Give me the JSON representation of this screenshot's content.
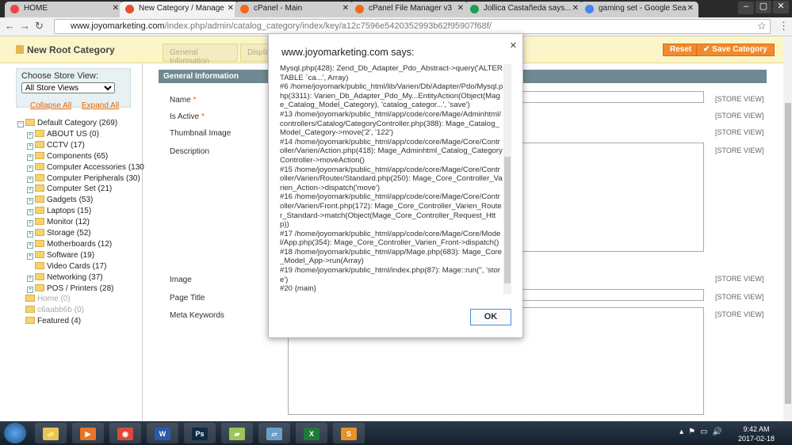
{
  "browser": {
    "tabs": [
      {
        "label": "HOME",
        "icon": "chrome-home-icon",
        "color": "#e44"
      },
      {
        "label": "New Category / Manage",
        "icon": "magento-icon",
        "color": "#e5512a",
        "active": true
      },
      {
        "label": "cPanel - Main",
        "icon": "cpanel-icon",
        "color": "#f26a1b"
      },
      {
        "label": "cPanel File Manager v3",
        "icon": "cpanel-icon",
        "color": "#f26a1b"
      },
      {
        "label": "Jollica Castañeda says...",
        "icon": "hangouts-icon",
        "color": "#1f9d55"
      },
      {
        "label": "gaming set - Google Sea",
        "icon": "google-icon",
        "color": "#4285f4"
      }
    ],
    "url_domain": "www.joyomarketing.com",
    "url_path": "/index.php/admin/catalog_category/index/key/a12c7596e5420352993b62f95907f68f/"
  },
  "header": {
    "title": "New Root Category",
    "reset": "Reset",
    "save": "Save Category",
    "tabs": [
      "General Information",
      "Displa"
    ]
  },
  "sidebar": {
    "store_label": "Choose Store View:",
    "store_value": "All Store Views",
    "collapse": "Collapse All",
    "expand": "Expand All",
    "tree": [
      {
        "label": "Default Category (269)",
        "level": 0,
        "expanded": true
      },
      {
        "label": "ABOUT US (0)",
        "level": 1
      },
      {
        "label": "CCTV (17)",
        "level": 1
      },
      {
        "label": "Components (65)",
        "level": 1
      },
      {
        "label": "Computer Accessories (130",
        "level": 1
      },
      {
        "label": "Computer Peripherals (30)",
        "level": 1
      },
      {
        "label": "Computer Set (21)",
        "level": 1
      },
      {
        "label": "Gadgets (53)",
        "level": 1
      },
      {
        "label": "Laptops (15)",
        "level": 1
      },
      {
        "label": "Monitor (12)",
        "level": 1
      },
      {
        "label": "Storage (52)",
        "level": 1
      },
      {
        "label": "Motherboards (12)",
        "level": 1
      },
      {
        "label": "Software (19)",
        "level": 1
      },
      {
        "label": "Video Cards (17)",
        "level": 1,
        "leaf": true
      },
      {
        "label": "Networking (37)",
        "level": 1
      },
      {
        "label": "POS / Printers (28)",
        "level": 1
      },
      {
        "label": "Home (0)",
        "level": 0,
        "dim": true
      },
      {
        "label": "c6aabb6b (0)",
        "level": 0,
        "dim": true
      },
      {
        "label": "Featured (4)",
        "level": 0
      }
    ]
  },
  "form": {
    "section": "General Information",
    "store_view": "[STORE VIEW]",
    "fields": [
      {
        "label": "Name",
        "required": true
      },
      {
        "label": "Is Active",
        "required": true
      },
      {
        "label": "Thumbnail Image"
      },
      {
        "label": "Description"
      },
      {
        "label": "Image"
      },
      {
        "label": "Page Title"
      },
      {
        "label": "Meta Keywords"
      }
    ]
  },
  "dialog": {
    "title": "www.joyomarketing.com says:",
    "message": "Mysql.php(428): Zend_Db_Adapter_Pdo_Abstract->query('ALTER TABLE `ca...', Array)\n#6 /home/joyomark/public_html/lib/Varien/Db/Adapter/Pdo/Mysql.php(3311): Varien_Db_Adapter_Pdo_My...EntityAction(Object(Mage_Catalog_Model_Category), 'catalog_categor...', 'save')\n#13 /home/joyomark/public_html/app/code/core/Mage/Adminhtml/controllers/Catalog/CategoryController.php(388): Mage_Catalog_Model_Category->move('2', '122')\n#14 /home/joyomark/public_html/app/code/core/Mage/Core/Controller/Varien/Action.php(418): Mage_Adminhtml_Catalog_CategoryController->moveAction()\n#15 /home/joyomark/public_html/app/code/core/Mage/Core/Controller/Varien/Router/Standard.php(250): Mage_Core_Controller_Varien_Action->dispatch('move')\n#16 /home/joyomark/public_html/app/code/core/Mage/Core/Controller/Varien/Front.php(172): Mage_Core_Controller_Varien_Router_Standard->match(Object(Mage_Core_Controller_Request_Http))\n#17 /home/joyomark/public_html/app/code/core/Mage/Core/Model/App.php(354): Mage_Core_Controller_Varien_Front->dispatch()\n#18 /home/joyomark/public_html/app/Mage.php(683): Mage_Core_Model_App->run(Array)\n#19 /home/joyomark/public_html/index.php(87): Mage::run('', 'store')\n#20 {main}",
    "ok": "OK"
  },
  "taskbar": {
    "apps": [
      {
        "name": "explorer",
        "glyph": "📁",
        "color": "#e8c45a"
      },
      {
        "name": "media-player",
        "glyph": "▶",
        "color": "#e8742a"
      },
      {
        "name": "chrome",
        "glyph": "◉",
        "color": "#d94a3a"
      },
      {
        "name": "word",
        "glyph": "W",
        "color": "#2b5aa8"
      },
      {
        "name": "photoshop",
        "glyph": "Ps",
        "color": "#0f2a44"
      },
      {
        "name": "sticky-notes",
        "glyph": "▰",
        "color": "#9bc45a"
      },
      {
        "name": "notes",
        "glyph": "▱",
        "color": "#6aa0c8"
      },
      {
        "name": "excel",
        "glyph": "X",
        "color": "#1f7a3a"
      },
      {
        "name": "skype",
        "glyph": "S",
        "color": "#e8902a"
      }
    ],
    "time": "9:42 AM",
    "date": "2017-02-18"
  }
}
